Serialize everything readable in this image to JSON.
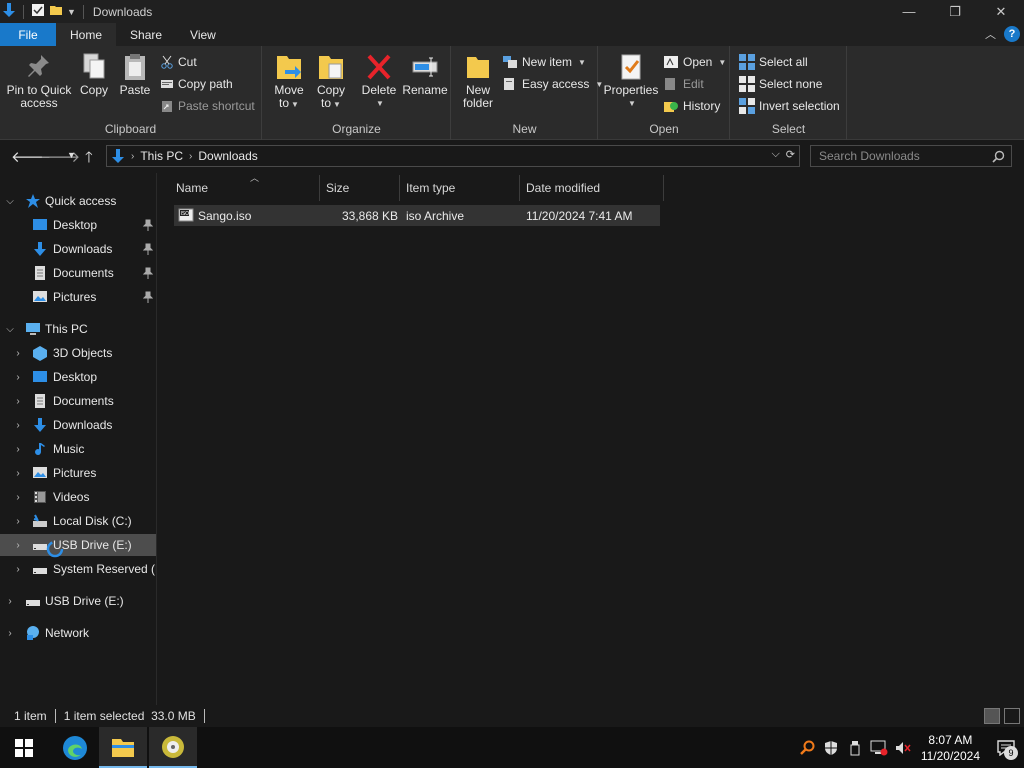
{
  "window": {
    "title": "Downloads"
  },
  "ribbon_tabs": [
    {
      "label": "File"
    },
    {
      "label": "Home"
    },
    {
      "label": "Share"
    },
    {
      "label": "View"
    }
  ],
  "ribbon": {
    "clipboard": {
      "label": "Clipboard",
      "pin_line1": "Pin to Quick",
      "pin_line2": "access",
      "copy": "Copy",
      "paste": "Paste",
      "cut": "Cut",
      "copy_path": "Copy path",
      "paste_shortcut": "Paste shortcut"
    },
    "organize": {
      "label": "Organize",
      "move_line1": "Move",
      "move_line2": "to",
      "copy_line1": "Copy",
      "copy_line2": "to",
      "delete": "Delete",
      "rename": "Rename"
    },
    "new": {
      "label": "New",
      "folder_line1": "New",
      "folder_line2": "folder",
      "new_item": "New item",
      "easy_access": "Easy access"
    },
    "open": {
      "label": "Open",
      "properties": "Properties",
      "open": "Open",
      "edit": "Edit",
      "history": "History"
    },
    "select": {
      "label": "Select",
      "select_all": "Select all",
      "select_none": "Select none",
      "invert": "Invert selection"
    }
  },
  "address": {
    "crumbs": [
      "This PC",
      "Downloads"
    ],
    "search_placeholder": "Search Downloads"
  },
  "nav": {
    "quick_access": "Quick access",
    "quick_items": [
      "Desktop",
      "Downloads",
      "Documents",
      "Pictures"
    ],
    "this_pc": "This PC",
    "pc_items": [
      "3D Objects",
      "Desktop",
      "Documents",
      "Downloads",
      "Music",
      "Pictures",
      "Videos",
      "Local Disk (C:)",
      "USB Drive (E:)",
      "System Reserved (M"
    ],
    "usb": "USB Drive (E:)",
    "network": "Network"
  },
  "file_list": {
    "columns": [
      "Name",
      "Size",
      "Item type",
      "Date modified"
    ],
    "rows": [
      {
        "name": "Sango.iso",
        "size": "33,868 KB",
        "type": "iso Archive",
        "modified": "11/20/2024 7:41 AM"
      }
    ]
  },
  "status": {
    "count": "1 item",
    "selected": "1 item selected  33.0 MB"
  },
  "taskbar": {
    "time": "8:07 AM",
    "date": "11/20/2024",
    "notif_count": "9"
  },
  "colors": {
    "accent": "#1979ca",
    "background": "#191919",
    "ribbon": "#2b2b2b"
  }
}
